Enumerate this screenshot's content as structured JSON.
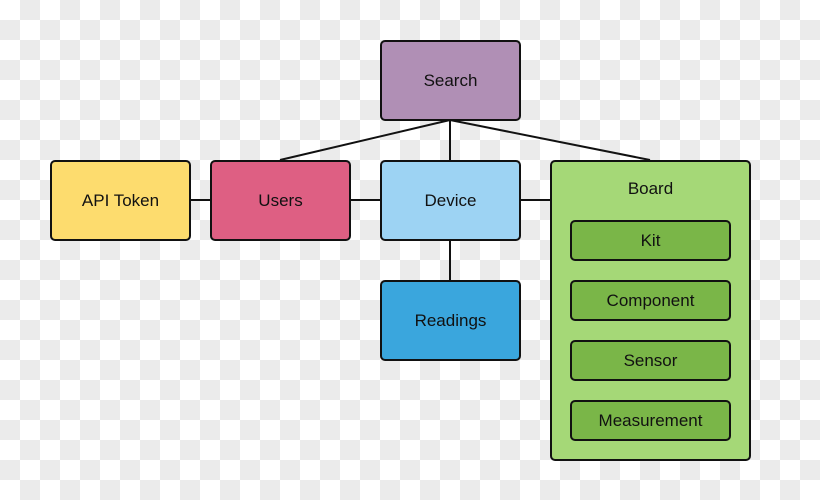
{
  "nodes": {
    "search": {
      "label": "Search",
      "color": "#b08fb5"
    },
    "api_token": {
      "label": "API Token",
      "color": "#fddc6e"
    },
    "users": {
      "label": "Users",
      "color": "#de5f83"
    },
    "device": {
      "label": "Device",
      "color": "#9dd3f3"
    },
    "readings": {
      "label": "Readings",
      "color": "#3aa6dd"
    },
    "board": {
      "label": "Board",
      "color": "#a5d877"
    },
    "kit": {
      "label": "Kit",
      "color": "#7ab648"
    },
    "component": {
      "label": "Component",
      "color": "#7ab648"
    },
    "sensor": {
      "label": "Sensor",
      "color": "#7ab648"
    },
    "measurement": {
      "label": "Measurement",
      "color": "#7ab648"
    }
  },
  "edges": [
    [
      "search",
      "users"
    ],
    [
      "search",
      "device"
    ],
    [
      "search",
      "board"
    ],
    [
      "api_token",
      "users"
    ],
    [
      "users",
      "device"
    ],
    [
      "device",
      "board"
    ],
    [
      "device",
      "readings"
    ],
    [
      "kit",
      "component"
    ],
    [
      "component",
      "sensor"
    ],
    [
      "sensor",
      "measurement"
    ]
  ]
}
